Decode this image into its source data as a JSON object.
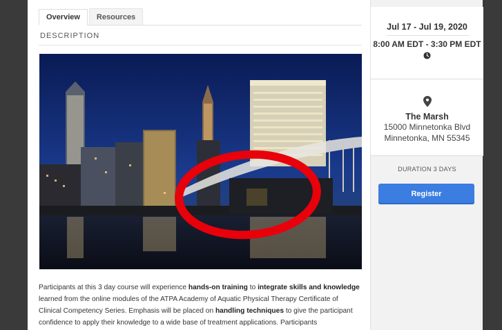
{
  "tabs": [
    {
      "label": "Overview",
      "active": true
    },
    {
      "label": "Resources",
      "active": false
    }
  ],
  "description": {
    "heading": "DESCRIPTION",
    "body": [
      {
        "text": "Participants at this 3 day course will experience "
      },
      {
        "text": "hands-on training",
        "bold": true
      },
      {
        "text": " to "
      },
      {
        "text": "integrate skills and knowledge",
        "bold": true
      },
      {
        "text": " learned from the online modules of the ATPA Academy of Aquatic Physical Therapy Certificate of Clinical Competency Series. Emphasis will be placed on "
      },
      {
        "text": "handling techniques",
        "bold": true
      },
      {
        "text": " to give the participant confidence to apply their knowledge to a wide base of treatment applications. Participants"
      }
    ]
  },
  "event": {
    "date_range": "Jul 17 - Jul 19, 2020",
    "time_range": "8:00 AM EDT - 3:30 PM EDT",
    "venue_name": "The Marsh",
    "address_line1": "15000 Minnetonka Blvd",
    "address_line2": "Minnetonka, MN 55345",
    "duration": "DURATION 3 DAYS",
    "register_label": "Register"
  },
  "icons": {
    "clock": "clock-icon",
    "location": "map-pin-icon"
  },
  "colors": {
    "accent": "#3b7de0",
    "annotation_circle": "#e8000b",
    "rail": "#3a3a3a"
  }
}
